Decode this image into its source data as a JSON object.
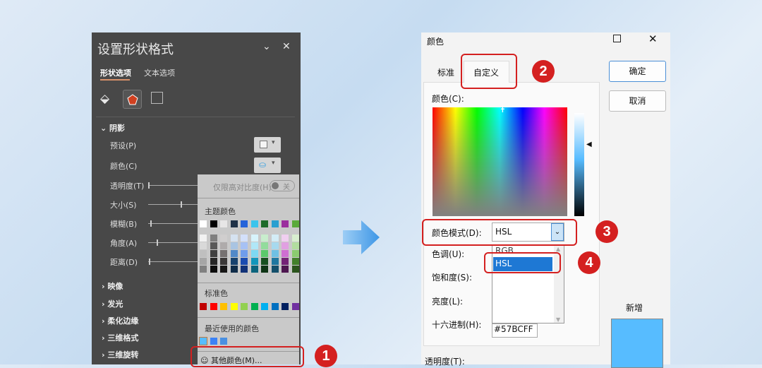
{
  "left_panel": {
    "title": "设置形状格式",
    "tabs": [
      "形状选项",
      "文本选项"
    ],
    "section_shadow": "阴影",
    "rows": [
      "预设(P)",
      "颜色(C)",
      "透明度(T)",
      "大小(S)",
      "模糊(B)",
      "角度(A)",
      "距离(D)"
    ],
    "sections": [
      "映像",
      "发光",
      "柔化边缘",
      "三维格式",
      "三维旋转"
    ]
  },
  "color_popup": {
    "high_contrast_label": "仅限高对比度(H)",
    "toggle_state": "关",
    "theme_colors_label": "主题颜色",
    "theme_colors": [
      "#ffffff",
      "#000000",
      "#e7e6e6",
      "#1f3147",
      "#2563d9",
      "#3cc4ec",
      "#1e6b2a",
      "#2a9fd0",
      "#9b2f9e",
      "#5aaa3a"
    ],
    "theme_shades": [
      [
        "#f2f2f2",
        "#d9d9d9",
        "#bfbfbf",
        "#a6a6a6",
        "#808080"
      ],
      [
        "#7f7f7f",
        "#595959",
        "#404040",
        "#262626",
        "#0d0d0d"
      ],
      [
        "#d0cece",
        "#afabab",
        "#767171",
        "#3b3838",
        "#181717"
      ],
      [
        "#d5e2f0",
        "#a9c4e2",
        "#5189c8",
        "#17426e",
        "#0f2c49"
      ],
      [
        "#d3e0fa",
        "#a7c1f4",
        "#6f9cec",
        "#1a4bb0",
        "#113278"
      ],
      [
        "#d7f3fb",
        "#b0e7f7",
        "#7ed9f3",
        "#1396bb",
        "#0c647d"
      ],
      [
        "#c8edcd",
        "#92dc9c",
        "#5bca6b",
        "#164f1f",
        "#0e3515"
      ],
      [
        "#d3ecf6",
        "#a7d9ee",
        "#6fc0e4",
        "#1f77a0",
        "#144f6b"
      ],
      [
        "#f0cff0",
        "#e1a0e2",
        "#cf6fd2",
        "#742376",
        "#4d174f"
      ],
      [
        "#d8eecf",
        "#b2dd9f",
        "#8bcc6f",
        "#43802b",
        "#2c551d"
      ]
    ],
    "standard_colors_label": "标准色",
    "standard_colors": [
      "#c00000",
      "#ff0000",
      "#ffc000",
      "#ffff00",
      "#92d050",
      "#00b050",
      "#00b0f0",
      "#0070c0",
      "#002060",
      "#7030a0"
    ],
    "recent_colors_label": "最近使用的颜色",
    "recent_colors": [
      "#57bcff",
      "#3b82f6",
      "#4a90e2"
    ],
    "more_colors": "其他颜色(M)..."
  },
  "badges": [
    "1",
    "2",
    "3",
    "4"
  ],
  "dialog": {
    "title": "颜色",
    "tabs": [
      "标准",
      "自定义"
    ],
    "ok": "确定",
    "cancel": "取消",
    "color_label": "颜色(C):",
    "mode_label": "颜色模式(D):",
    "mode_value": "HSL",
    "mode_options": [
      "RGB",
      "HSL"
    ],
    "hue_label": "色调(U):",
    "sat_label": "饱和度(S):",
    "lum_label": "亮度(L):",
    "hex_label": "十六进制(H):",
    "hex_value": "#57BCFF",
    "transparency_label": "透明度(T):",
    "new_label": "新增",
    "new_color": "#57BCFF"
  }
}
